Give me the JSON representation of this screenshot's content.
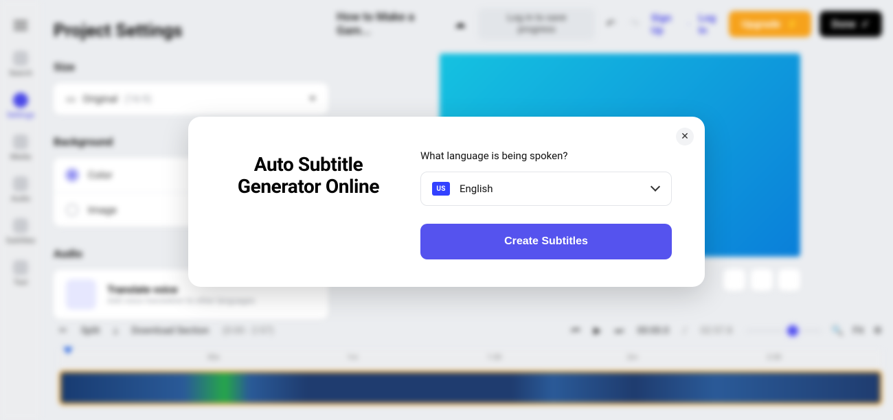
{
  "rail": {
    "items": [
      {
        "label": "Search"
      },
      {
        "label": "Settings"
      },
      {
        "label": "Media"
      },
      {
        "label": "Audio"
      },
      {
        "label": "Subtitles"
      },
      {
        "label": "Text"
      }
    ]
  },
  "panel": {
    "title": "Project Settings",
    "size_heading": "Size",
    "size_value": "Original",
    "size_aspect": "(16:9)",
    "background_heading": "Background",
    "bg_color_label": "Color",
    "bg_image_label": "Image",
    "audio_heading": "Audio",
    "translate_title": "Translate voice",
    "translate_subtitle": "Add voice translation to other languages"
  },
  "topbar": {
    "project_name": "How to Make a Gam...",
    "login_save": "Log in to save progress",
    "sign_up": "Sign Up",
    "log_in": "Log In",
    "upgrade": "Upgrade",
    "done": "Done"
  },
  "toolbar": {
    "split": "Split",
    "download_section": "Download Section",
    "section_range": "(0:00 - 2:57)",
    "time_current": "00:00.0",
    "time_sep": "/",
    "time_total": "02:57.8",
    "fit": "Fit"
  },
  "timeline": {
    "marks": [
      "30s",
      "1m",
      "1:30",
      "2m",
      "2:30"
    ]
  },
  "modal": {
    "title": "Auto Subtitle Generator Online",
    "question": "What language is being spoken?",
    "flag_code": "US",
    "language": "English",
    "create": "Create Subtitles"
  }
}
